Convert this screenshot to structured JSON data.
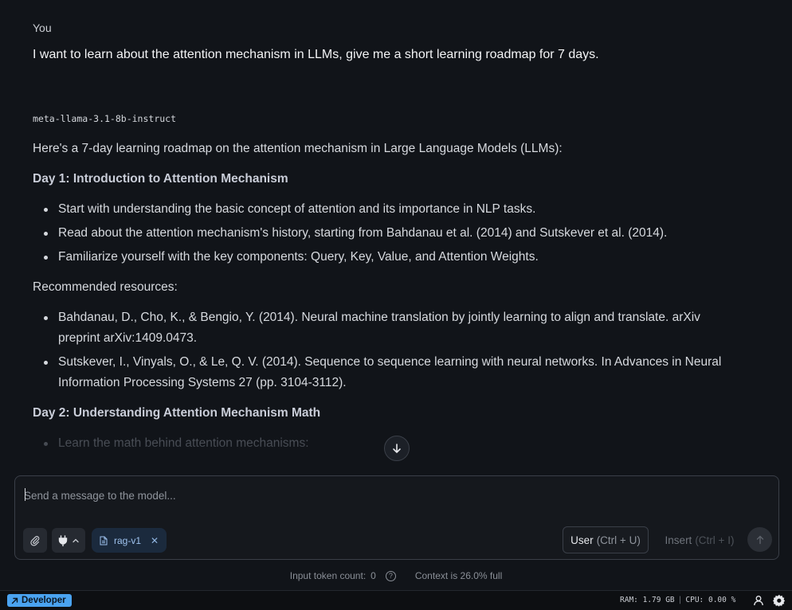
{
  "conversation": {
    "user_label": "You",
    "user_message": "I want to learn about the attention mechanism in LLMs, give me a short learning roadmap for 7 days.",
    "model_name": "meta-llama-3.1-8b-instruct",
    "response": {
      "intro": "Here's a 7-day learning roadmap on the attention mechanism in Large Language Models (LLMs):",
      "day1_heading": "Day 1: Introduction to Attention Mechanism",
      "day1_items": [
        "Start with understanding the basic concept of attention and its importance in NLP tasks.",
        "Read about the attention mechanism's history, starting from Bahdanau et al. (2014) and Sutskever et al. (2014).",
        "Familiarize yourself with the key components: Query, Key, Value, and Attention Weights."
      ],
      "resources_label": "Recommended resources:",
      "resources": [
        "Bahdanau, D., Cho, K., & Bengio, Y. (2014). Neural machine translation by jointly learning to align and translate. arXiv preprint arXiv:1409.0473.",
        "Sutskever, I., Vinyals, O., & Le, Q. V. (2014). Sequence to sequence learning with neural networks. In Advances in Neural Information Processing Systems 27 (pp. 3104-3112)."
      ],
      "day2_heading": "Day 2: Understanding Attention Mechanism Math",
      "day2_items": [
        "Learn the math behind attention mechanisms:"
      ]
    }
  },
  "composer": {
    "placeholder": "Send a message to the model...",
    "attachment_chip": "rag-v1",
    "role_button": "User",
    "role_shortcut": "(Ctrl + U)",
    "insert_button": "Insert",
    "insert_shortcut": "(Ctrl + I)"
  },
  "context_info": {
    "token_count_label": "Input token count:",
    "token_count": "0",
    "context_text": "Context is 26.0% full"
  },
  "status_bar": {
    "mode_badge": "Developer",
    "ram": "RAM: 1.79 GB",
    "separator": "|",
    "cpu": "CPU: 0.00 %"
  },
  "colors": {
    "background": "#111419",
    "accent": "#4aa3f0",
    "chip_text": "#9fc3ef"
  }
}
